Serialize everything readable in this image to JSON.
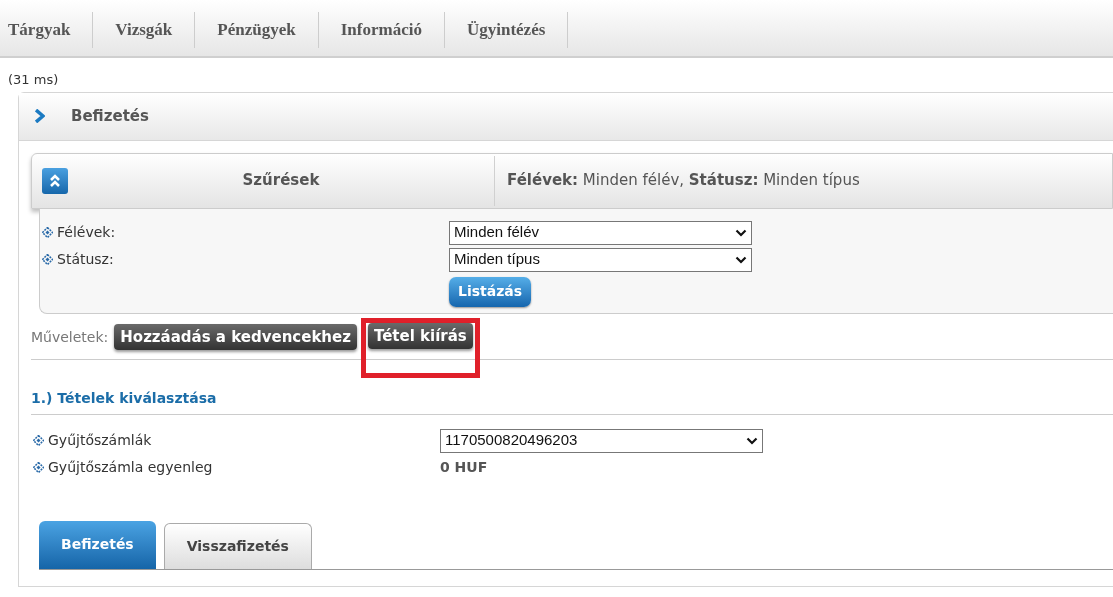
{
  "menu": [
    {
      "label": "Tárgyak"
    },
    {
      "label": "Vizsgák"
    },
    {
      "label": "Pénzügyek"
    },
    {
      "label": "Információ"
    },
    {
      "label": "Ügyintézés"
    }
  ],
  "timing": "(31 ms)",
  "panel": {
    "title": "Befizetés"
  },
  "filters": {
    "title": "Szűrések",
    "summary": "**Félévek:** Minden félév, **Státusz:** Minden típus",
    "fields": [
      {
        "label": "Félévek:",
        "value": "Minden félév"
      },
      {
        "label": "Státusz:",
        "value": "Minden típus"
      }
    ],
    "button": "Listázás"
  },
  "actions": {
    "label": "Műveletek:",
    "buttons": [
      {
        "label": "Hozzáadás a kedvencekhez",
        "highlighted": false
      },
      {
        "label": "Tétel kiírás",
        "highlighted": true
      }
    ]
  },
  "section": {
    "title": "1.) Tételek kiválasztása",
    "fields": [
      {
        "kind": "select",
        "label": "Gyűjtőszámlák",
        "value": "1170500820496203"
      },
      {
        "kind": "text",
        "label": "Gyűjtőszámla egyenleg",
        "value": "0 HUF"
      }
    ]
  },
  "tabs": [
    {
      "label": "Befizetés",
      "selected": true
    },
    {
      "label": "Visszafizetés",
      "selected": false
    }
  ]
}
